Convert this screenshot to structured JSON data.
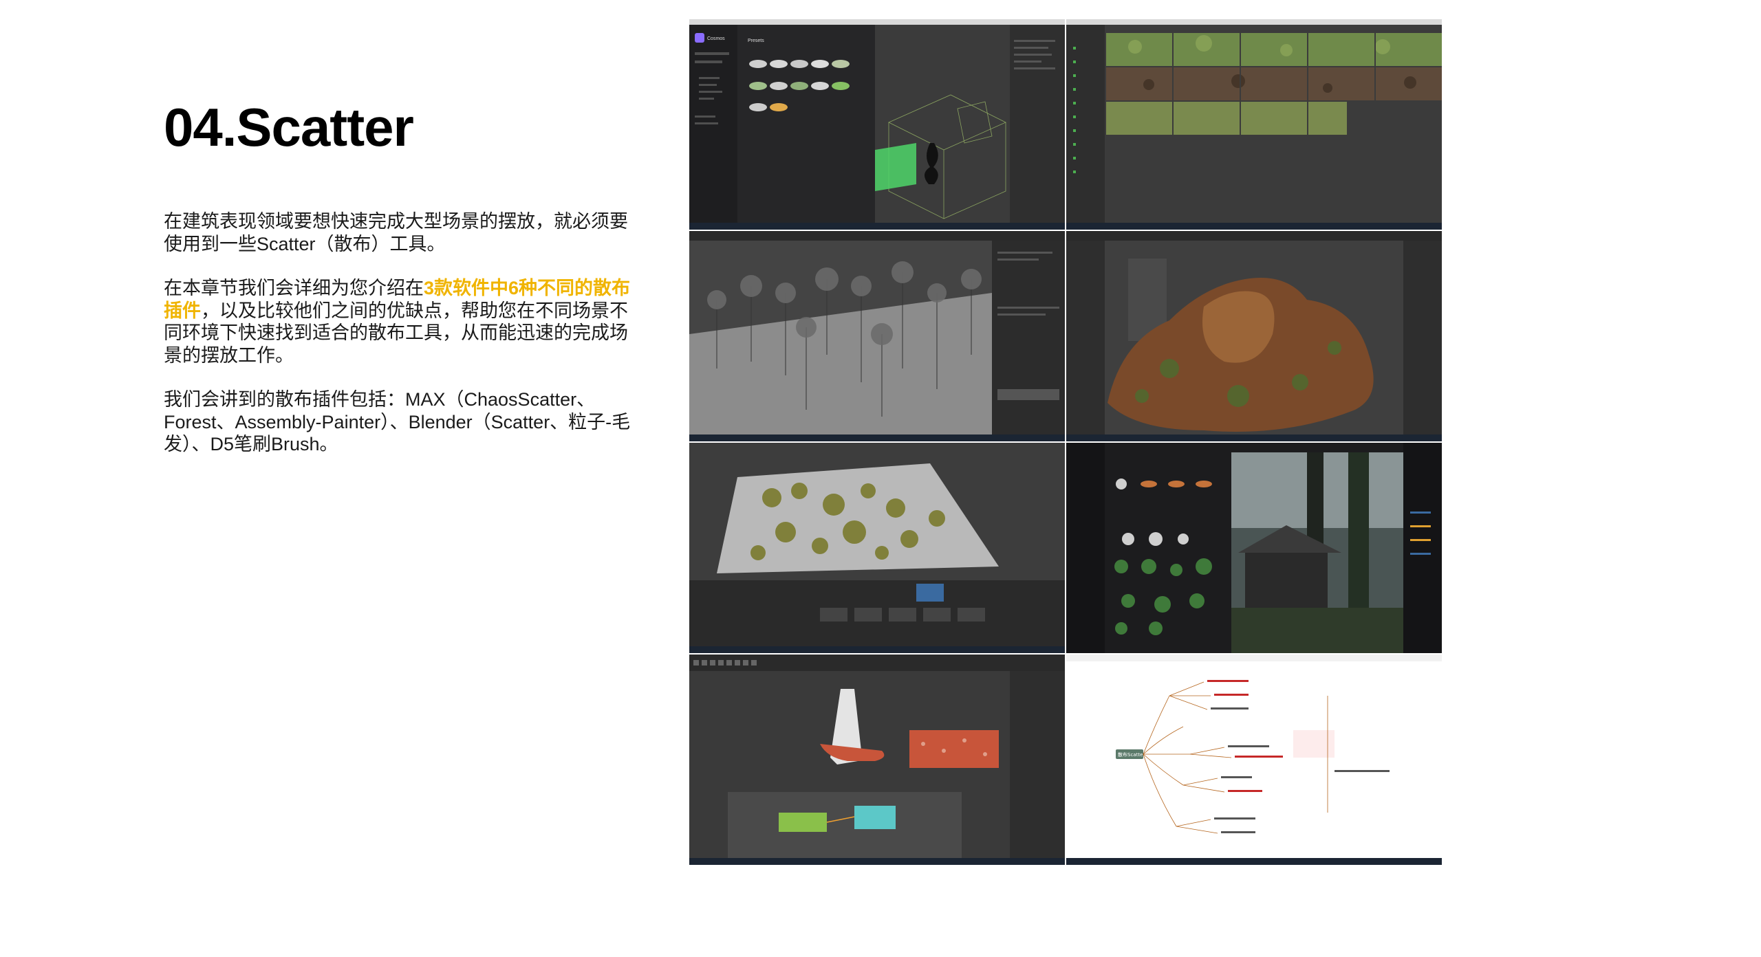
{
  "slide": {
    "title": "04.Scatter",
    "paragraph1": "在建筑表现领域要想快速完成大型场景的摆放，就必须要使用到一些Scatter（散布）工具。",
    "paragraph2_before": "在本章节我们会详细为您介绍在",
    "paragraph2_highlight": "3款软件中6种不同的散布插件",
    "paragraph2_after": "，以及比较他们之间的优缺点，帮助您在不同场景不同环境下快速找到适合的散布工具，从而能迅速的完成场景的摆放工作。",
    "paragraph3": "我们会讲到的散布插件包括：MAX（ChaosScatter、Forest、Assembly-Painter）、Blender（Scatter、粒子-毛发）、D5笔刷Brush。",
    "highlight_color": "#f0b400"
  },
  "screenshots": {
    "cosmos_title": "Cosmos",
    "cosmos_tab": "Presets",
    "mindmap_root": "散布Scatter"
  }
}
